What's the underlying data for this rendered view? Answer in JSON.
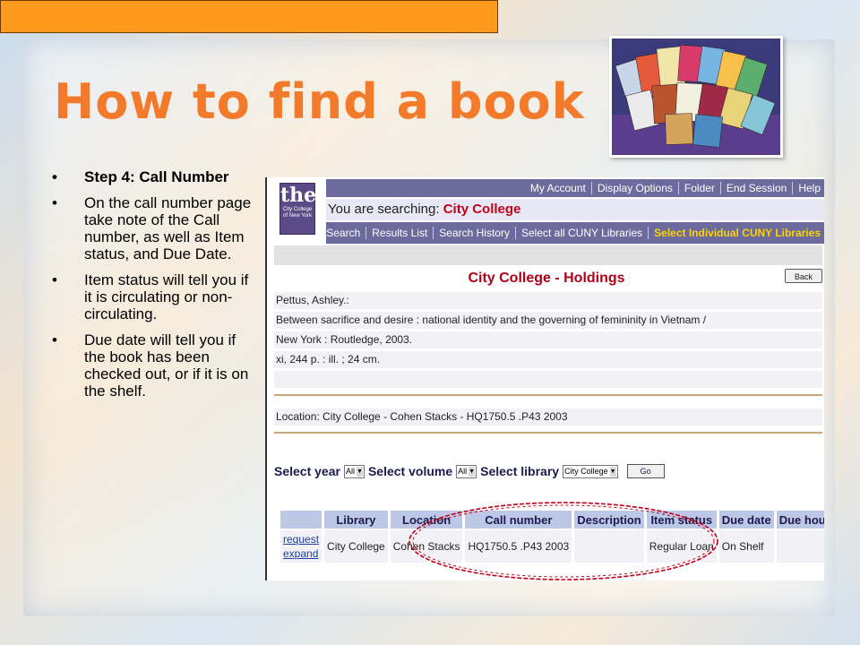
{
  "slide": {
    "title": "How to find a book",
    "bullets": [
      "Step 4: Call Number",
      "On the call number page take note of the Call number, as well as Item status, and Due Date.",
      "Item status will tell you if it is circulating or non-circulating.",
      "Due date will tell you if the book has been checked out, or if it is on the shelf."
    ]
  },
  "catalog": {
    "logo": {
      "the": "the",
      "line1": "City College",
      "line2": "of New York"
    },
    "top_nav": [
      "My Account",
      "Display Options",
      "Folder",
      "End Session",
      "Help"
    ],
    "searching_label": "You are searching:",
    "searching_value": "City College",
    "bottom_nav": [
      "Search",
      "Results List",
      "Search History",
      "Select all CUNY Libraries",
      "Select Individual CUNY Libraries"
    ],
    "holdings_title": "City College - Holdings",
    "back_label": "Back",
    "record": {
      "author": "Pettus, Ashley.:",
      "title": "Between sacrifice and desire :  national identity and the governing of femininity in Vietnam /",
      "publisher": " New York : Routledge, 2003.",
      "description": " xi, 244 p. : ill. ; 24 cm."
    },
    "location_line": "Location: City College - Cohen Stacks -  HQ1750.5 .P43 2003",
    "select": {
      "year_label": "Select year",
      "year_value": "All",
      "volume_label": "Select volume",
      "volume_value": "All",
      "library_label": "Select library",
      "library_value": "City College",
      "go_label": "Go"
    },
    "table": {
      "headers": [
        "Library",
        "Location",
        "Call number",
        "Description",
        "Item status",
        "Due date",
        "Due hour"
      ],
      "row": {
        "link1": "request",
        "link2": "expand",
        "library": "City College",
        "location": "Cohen Stacks",
        "call_number": "HQ1750.5 .P43 2003",
        "description": "",
        "item_status": "Regular Loan",
        "due_date": "On Shelf",
        "due_hour": ""
      }
    }
  },
  "colors": {
    "title": "#f47a2b",
    "accent_bar": "#ff9a1e",
    "nav": "#6b6b9d",
    "highlight_oval": "#c0001a"
  }
}
